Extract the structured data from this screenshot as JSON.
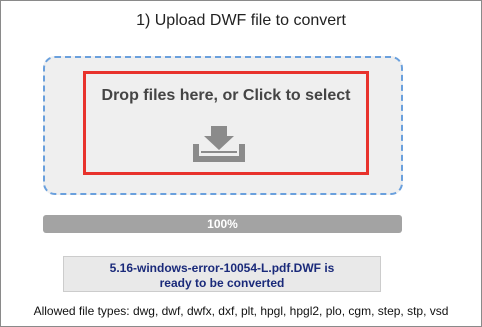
{
  "step": {
    "title": "1) Upload DWF file to convert"
  },
  "dropzone": {
    "label": "Drop files here, or Click to select",
    "icon": "upload-tray-icon"
  },
  "progress": {
    "value_percent": 100,
    "label": "100%"
  },
  "file_status": {
    "line1": "5.16-windows-error-10054-L.pdf.DWF is",
    "line2": "ready to be converted"
  },
  "allowed_types": {
    "text": "Allowed file types: dwg, dwf, dwfx, dxf, plt, hpgl, hpgl2, plo, cgm, step, stp, vsd"
  },
  "colors": {
    "dropzone_border": "#6aa0dd",
    "highlight_border": "#e8322c",
    "status_text": "#1a2a7a",
    "progress_fill": "#a3a3a3"
  }
}
